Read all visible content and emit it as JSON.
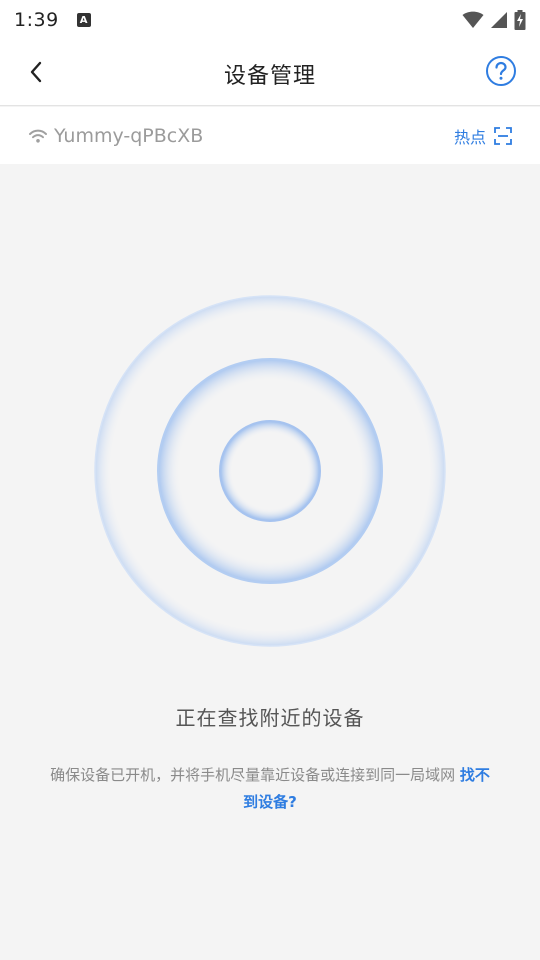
{
  "status_bar": {
    "time": "1:39",
    "notification_letter": "A"
  },
  "header": {
    "title": "设备管理",
    "back_icon": "chevron-left-icon",
    "help_icon": "help-circle-icon"
  },
  "wifi": {
    "ssid": "Yummy-qPBcXB",
    "hotspot_label": "热点"
  },
  "search": {
    "status_text": "正在查找附近的设备",
    "hint_text": "确保设备已开机，并将手机尽量靠近设备或连接到同一局域网",
    "link_text": "找不到设备?"
  },
  "colors": {
    "accent": "#2f7de1",
    "background": "#f4f4f4"
  }
}
